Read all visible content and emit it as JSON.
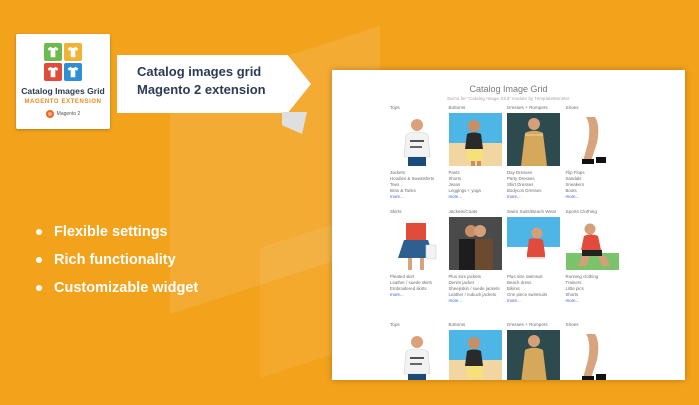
{
  "banner": {
    "colors": {
      "orange": "#f3a21c",
      "navy": "#2d3b57",
      "white": "#ffffff"
    },
    "logo": {
      "icon_name": "tshirt-grid-icon",
      "title": "Catalog Images Grid",
      "subtitle": "MAGENTO EXTENSION",
      "brand": "Magento 2"
    },
    "ribbon": {
      "line1": "Catalog images grid",
      "line2": "Magento 2 extension"
    },
    "features": [
      "Flexible settings",
      "Rich functionality",
      "Customizable widget"
    ],
    "preview": {
      "title": "Catalog Image Grid",
      "subtitle": "Demo for \"Catalog Image Grid\" module by TemplateMonster",
      "rows": [
        [
          {
            "title": "Tops",
            "list": [
              "Jackets",
              "Hoodies & Sweatshirts",
              "Tees",
              "Bras & Tanks"
            ],
            "more": "more..."
          },
          {
            "title": "Bottoms",
            "list": [
              "Pants",
              "Shorts",
              "Jeans",
              "Leggings + yoga"
            ],
            "more": "more..."
          },
          {
            "title": "Dresses + Rompers",
            "list": [
              "Day Dresses",
              "Party Dresses",
              "Shirt Dresses",
              "Bodycon Dresses"
            ],
            "more": "more..."
          },
          {
            "title": "Shoes",
            "list": [
              "Flip Flops",
              "Sandals",
              "Sneakers",
              "Boots"
            ],
            "more": "more..."
          }
        ],
        [
          {
            "title": "Skirts",
            "list": [
              "Pleated skirt",
              "Leather / suede skirts",
              "Embroidered skirts"
            ],
            "more": "more..."
          },
          {
            "title": "Jackets/Coats",
            "list": [
              "Plus size jackets",
              "Denim jacket",
              "Sheepskin / suede jackets",
              "Leather / nubuck jackets"
            ],
            "more": "more..."
          },
          {
            "title": "Swim Suits/Beach Wear",
            "list": [
              "Plus size swimsuit",
              "Beach dress",
              "Bikinis",
              "One piece swimsuits"
            ],
            "more": "more..."
          },
          {
            "title": "Sports Clothing",
            "list": [
              "Running clothing",
              "Trainers",
              "Little pics",
              "Shorts"
            ],
            "more": "more..."
          }
        ],
        [
          {
            "title": "Tops"
          },
          {
            "title": "Bottoms"
          },
          {
            "title": "Dresses + Rompers"
          },
          {
            "title": "Shoes"
          }
        ]
      ]
    }
  }
}
